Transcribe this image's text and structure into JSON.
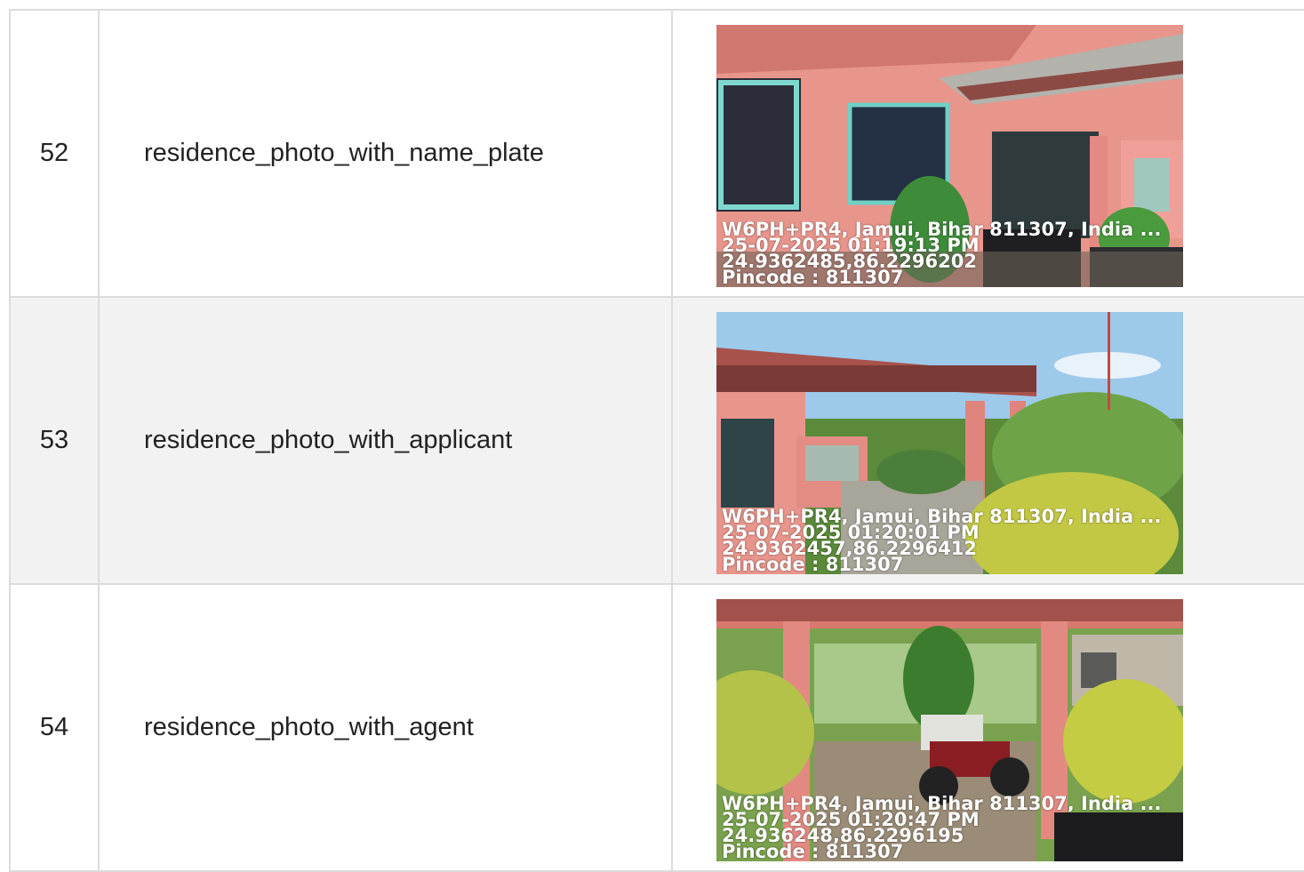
{
  "rows": [
    {
      "number": "52",
      "name": "residence_photo_with_name_plate",
      "photo": {
        "address": "W6PH+PR4, Jamui, Bihar 811307, India ...",
        "datetime": "25-07-2025 01:19:13 PM",
        "coords": "24.9362485,86.2296202",
        "pincode": "Pincode : 811307"
      }
    },
    {
      "number": "53",
      "name": "residence_photo_with_applicant",
      "photo": {
        "address": "W6PH+PR4, Jamui, Bihar 811307, India ...",
        "datetime": "25-07-2025 01:20:01 PM",
        "coords": "24.9362457,86.2296412",
        "pincode": "Pincode : 811307"
      }
    },
    {
      "number": "54",
      "name": "residence_photo_with_agent",
      "photo": {
        "address": "W6PH+PR4, Jamui, Bihar 811307, India ...",
        "datetime": "25-07-2025 01:20:47 PM",
        "coords": "24.936248,86.2296195",
        "pincode": "Pincode : 811307"
      }
    }
  ]
}
